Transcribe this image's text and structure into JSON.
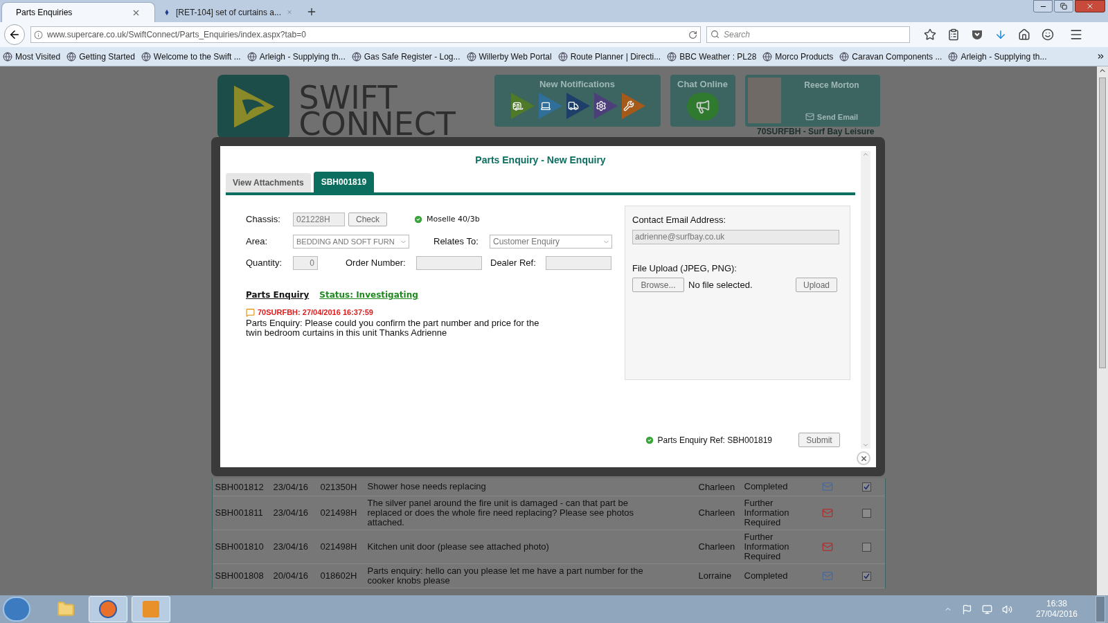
{
  "browser": {
    "tabs": [
      {
        "label": "Parts Enquiries",
        "selected": true
      },
      {
        "label": "[RET-104] set of curtains a...",
        "selected": false
      }
    ],
    "url": "www.supercare.co.uk/SwiftConnect/Parts_Enquiries/index.aspx?tab=0",
    "search": {
      "placeholder": "Search"
    },
    "bookmarks": [
      "Most Visited",
      "Getting Started",
      "Welcome to the Swift ...",
      "Arleigh - Supplying th...",
      "Gas Safe Register - Log...",
      "Willerby Web Portal",
      "Route Planner | Directi...",
      "BBC Weather : PL28",
      "Morco Products",
      "Caravan Components ...",
      "Arleigh - Supplying th..."
    ]
  },
  "header": {
    "logo": [
      "SWIFT",
      "CONNECT"
    ],
    "notifications_title": "New Notifications",
    "chat_title": "Chat Online",
    "user_name": "Reece Morton",
    "send_email": "Send Email",
    "dealer": "70SURFBH - Surf Bay Leisure"
  },
  "modal": {
    "title": "Parts Enquiry - New Enquiry",
    "tabs": [
      {
        "label": "View Attachments",
        "selected": false
      },
      {
        "label": "SBH001819",
        "selected": true
      }
    ],
    "form": {
      "chassis_label": "Chassis:",
      "chassis_value": "021228H",
      "check_button": "Check",
      "model": "Moselle 40/3b",
      "area_label": "Area:",
      "area_value": "BEDDING AND SOFT FURN",
      "relates_label": "Relates To:",
      "relates_value": "Customer Enquiry",
      "quantity_label": "Quantity:",
      "quantity_value": "0",
      "order_label": "Order Number:",
      "dealer_ref_label": "Dealer Ref:"
    },
    "section_title": "Parts Enquiry",
    "status": "Status: Investigating",
    "message": {
      "author": "70SURFBH: 27/04/2016 16:37:59",
      "body": "Parts Enquiry: Please could you confirm the part number and price for the twin bedroom curtains in this unit Thanks Adrienne"
    },
    "contact": {
      "email_label": "Contact Email Address:",
      "email_value": "adrienne@surfbay.co.uk",
      "upload_label": "File Upload (JPEG, PNG):",
      "browse_button": "Browse...",
      "file_status": "No file selected.",
      "upload_button": "Upload"
    },
    "reference": "Parts Enquiry Ref: SBH001819",
    "submit_button": "Submit"
  },
  "table": {
    "rows": [
      {
        "ref": "SBH001812",
        "date": "23/04/16",
        "chassis": "021350H",
        "description": "Shower hose needs replacing",
        "name": "Charleen",
        "status": "Completed",
        "kind": "plain",
        "checked": true
      },
      {
        "ref": "SBH001811",
        "date": "23/04/16",
        "chassis": "021498H",
        "description": "The silver panel around the fire unit is damaged - can that part be replaced or does the whole fire need replacing? Please see photos attached.",
        "name": "Charleen",
        "status": "Further Information Required",
        "kind": "alert",
        "checked": false
      },
      {
        "ref": "SBH001810",
        "date": "23/04/16",
        "chassis": "021498H",
        "description": "Kitchen unit door (please see attached photo)",
        "name": "Charleen",
        "status": "Further Information Required",
        "kind": "alert",
        "checked": false
      },
      {
        "ref": "SBH001808",
        "date": "20/04/16",
        "chassis": "018602H",
        "description": "Parts enquiry: hello can you please let me have a part number for the cooker knobs please",
        "name": "Lorraine",
        "status": "Completed",
        "kind": "plain",
        "checked": true
      }
    ]
  },
  "taskbar": {
    "time": "16:38",
    "date": "27/04/2016"
  }
}
